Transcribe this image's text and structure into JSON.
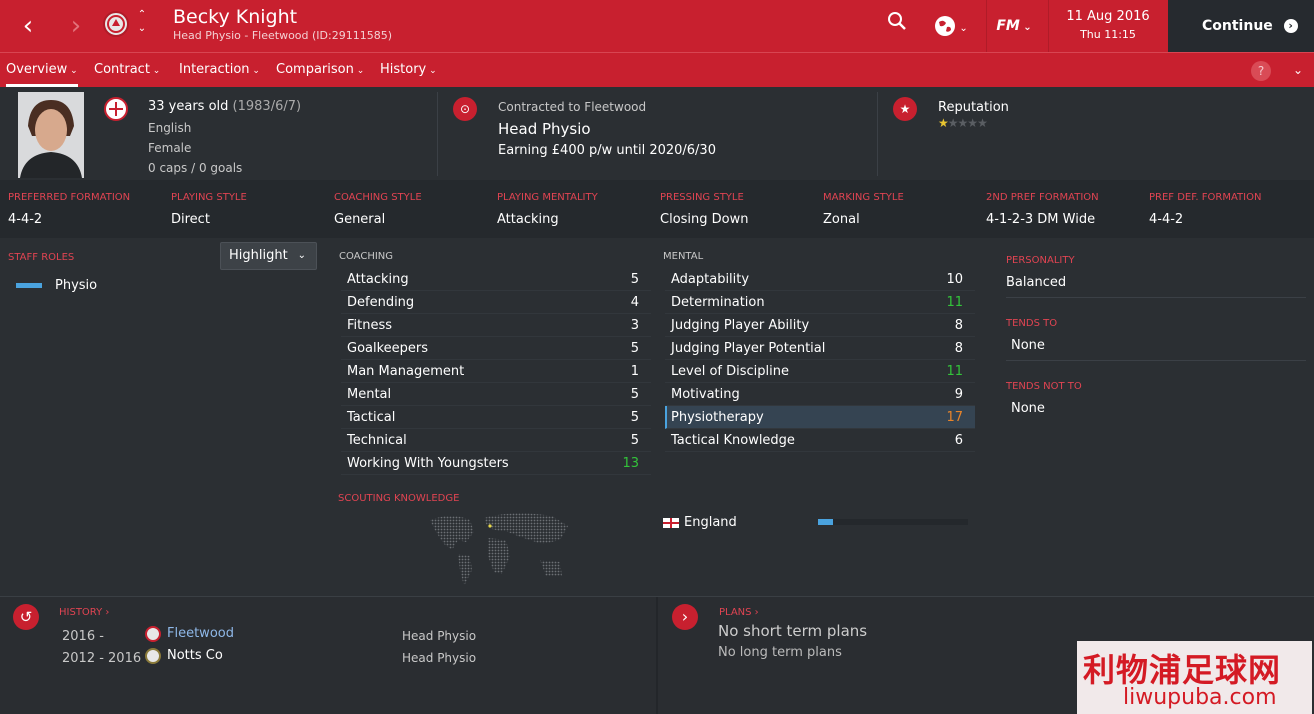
{
  "header": {
    "name": "Becky Knight",
    "subtitle": "Head Physio - Fleetwood (ID:29111585)",
    "date": "11 Aug 2016",
    "day": "Thu 11:15",
    "continue_label": "Continue",
    "fm_label": "FM"
  },
  "menu": {
    "items": [
      "Overview",
      "Contract",
      "Interaction",
      "Comparison",
      "History"
    ],
    "active": "Overview",
    "help": "?"
  },
  "profile": {
    "age": "33 years old",
    "dob": "(1983/6/7)",
    "nationality": "English",
    "gender": "Female",
    "caps": "0 caps / 0 goals",
    "contract_label": "Contracted to Fleetwood",
    "role": "Head Physio",
    "earning": "Earning £400 p/w until 2020/6/30",
    "reputation_label": "Reputation",
    "reputation_stars": 1,
    "reputation_max": 5
  },
  "styles": [
    {
      "label": "PREFERRED FORMATION",
      "value": "4-4-2"
    },
    {
      "label": "PLAYING STYLE",
      "value": "Direct"
    },
    {
      "label": "COACHING STYLE",
      "value": "General"
    },
    {
      "label": "PLAYING MENTALITY",
      "value": "Attacking"
    },
    {
      "label": "PRESSING STYLE",
      "value": "Closing Down"
    },
    {
      "label": "MARKING STYLE",
      "value": "Zonal"
    },
    {
      "label": "2ND PREF FORMATION",
      "value": "4-1-2-3 DM Wide"
    },
    {
      "label": "PREF DEF. FORMATION",
      "value": "4-4-2"
    }
  ],
  "staff_roles": {
    "heading": "STAFF ROLES",
    "highlight_label": "Highlight",
    "roles": [
      "Physio"
    ]
  },
  "coaching": {
    "heading": "COACHING",
    "items": [
      {
        "name": "Attacking",
        "value": "5"
      },
      {
        "name": "Defending",
        "value": "4"
      },
      {
        "name": "Fitness",
        "value": "3"
      },
      {
        "name": "Goalkeepers",
        "value": "5"
      },
      {
        "name": "Man Management",
        "value": "1"
      },
      {
        "name": "Mental",
        "value": "5"
      },
      {
        "name": "Tactical",
        "value": "5"
      },
      {
        "name": "Technical",
        "value": "5"
      },
      {
        "name": "Working With Youngsters",
        "value": "13"
      }
    ]
  },
  "mental": {
    "heading": "MENTAL",
    "items": [
      {
        "name": "Adaptability",
        "value": "10"
      },
      {
        "name": "Determination",
        "value": "11"
      },
      {
        "name": "Judging Player Ability",
        "value": "8"
      },
      {
        "name": "Judging Player Potential",
        "value": "8"
      },
      {
        "name": "Level of Discipline",
        "value": "11"
      },
      {
        "name": "Motivating",
        "value": "9"
      },
      {
        "name": "Physiotherapy",
        "value": "17"
      },
      {
        "name": "Tactical Knowledge",
        "value": "6"
      }
    ]
  },
  "personality": {
    "heading": "PERSONALITY",
    "value": "Balanced",
    "tends_to_heading": "TENDS TO",
    "tends_to": "None",
    "tends_not_heading": "TENDS NOT TO",
    "tends_not": "None"
  },
  "scouting": {
    "heading": "SCOUTING KNOWLEDGE",
    "country": "England",
    "knowledge_fraction": 0.1
  },
  "history": {
    "heading": "HISTORY",
    "rows": [
      {
        "years": "2016 -",
        "club": "Fleetwood",
        "role": "Head Physio"
      },
      {
        "years": "2012 - 2016",
        "club": "Notts Co",
        "role": "Head Physio"
      }
    ]
  },
  "plans": {
    "heading": "PLANS",
    "short": "No short term plans",
    "long": "No long term plans"
  },
  "watermark": {
    "text1": "利物浦足球网",
    "text2": "liwupuba.com"
  },
  "colors": {
    "brand_red": "#c8202f",
    "high_value": "#33c33a",
    "top_value": "#e8842a",
    "panel": "#2b2f33"
  }
}
